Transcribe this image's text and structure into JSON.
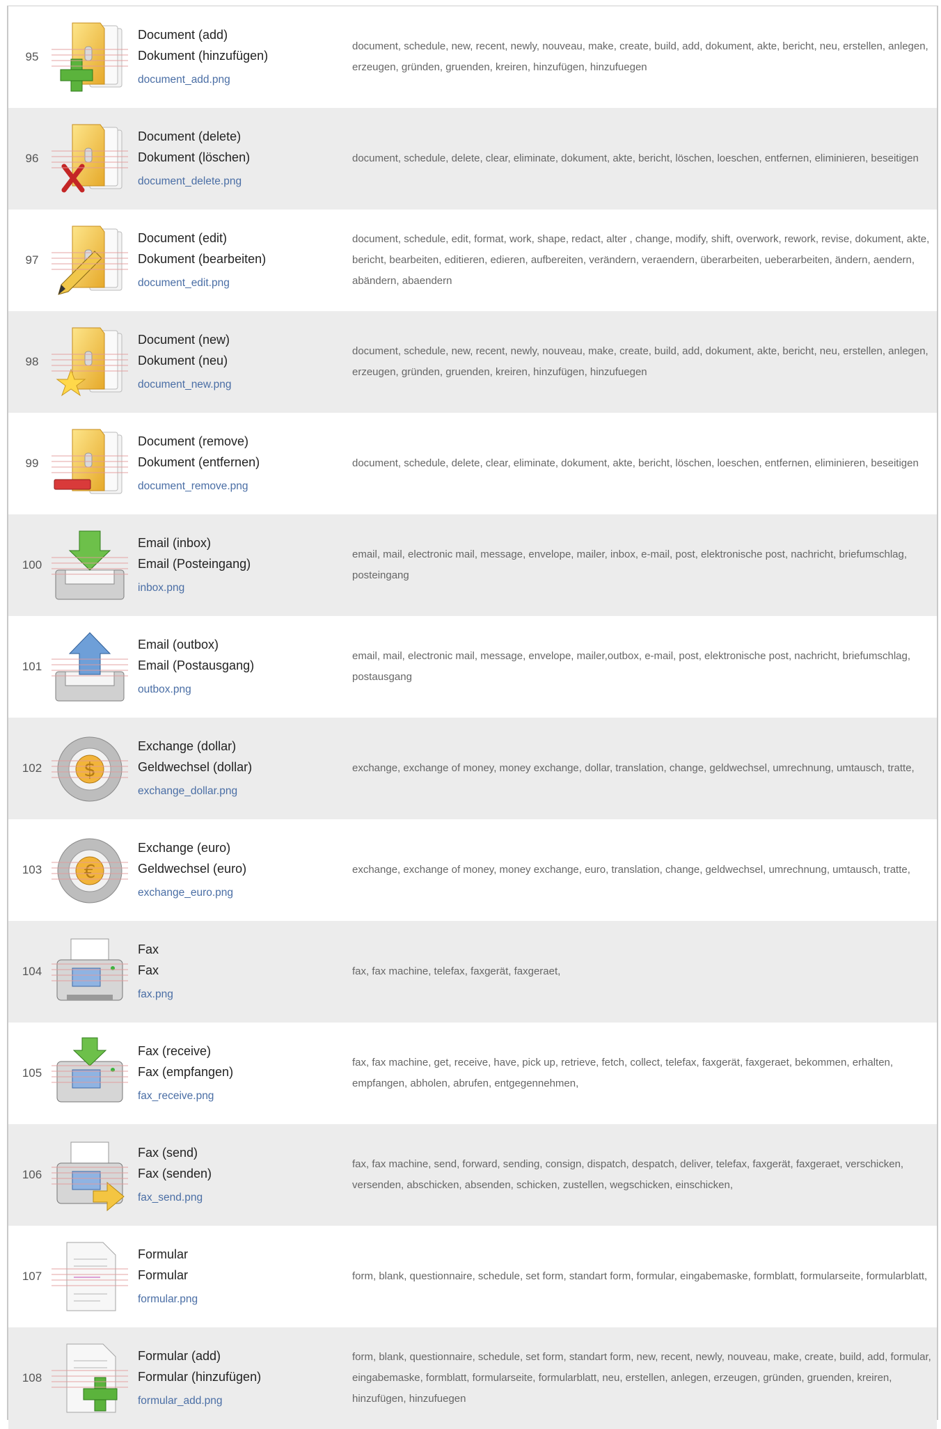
{
  "rows": [
    {
      "num": "95",
      "name1": "Document (add)",
      "name2": "Dokument (hinzufügen)",
      "file": "document_add.png",
      "icon": "document-add-icon",
      "keywords": "document, schedule, new, recent, newly, nouveau, make, create, build, add, dokument, akte, bericht, neu, erstellen, anlegen, erzeugen, gründen, gruenden, kreiren, hinzufügen, hinzufuegen"
    },
    {
      "num": "96",
      "name1": "Document (delete)",
      "name2": "Dokument (löschen)",
      "file": "document_delete.png",
      "icon": "document-delete-icon",
      "keywords": "document, schedule, delete, clear, eliminate, dokument, akte, bericht, löschen, loeschen, entfernen, eliminieren, beseitigen"
    },
    {
      "num": "97",
      "name1": "Document (edit)",
      "name2": "Dokument (bearbeiten)",
      "file": "document_edit.png",
      "icon": "document-edit-icon",
      "keywords": "document, schedule, edit, format, work, shape, redact, alter , change, modify, shift, overwork, rework, revise, dokument, akte, bericht, bearbeiten, editieren, edieren, aufbereiten, verändern, veraendern, überarbeiten, ueberarbeiten, ändern, aendern, abändern, abaendern"
    },
    {
      "num": "98",
      "name1": "Document (new)",
      "name2": "Dokument (neu)",
      "file": "document_new.png",
      "icon": "document-new-icon",
      "keywords": "document, schedule, new, recent, newly, nouveau, make, create, build, add, dokument, akte, bericht, neu, erstellen, anlegen, erzeugen, gründen, gruenden, kreiren, hinzufügen, hinzufuegen"
    },
    {
      "num": "99",
      "name1": "Document (remove)",
      "name2": "Dokument (entfernen)",
      "file": "document_remove.png",
      "icon": "document-remove-icon",
      "keywords": "document, schedule, delete, clear, eliminate, dokument, akte, bericht, löschen, loeschen, entfernen, eliminieren, beseitigen"
    },
    {
      "num": "100",
      "name1": "Email (inbox)",
      "name2": "Email (Posteingang)",
      "file": "inbox.png",
      "icon": "inbox-icon",
      "keywords": "email, mail, electronic mail, message, envelope, mailer, inbox, e-mail, post, elektronische post, nachricht, briefumschlag, posteingang"
    },
    {
      "num": "101",
      "name1": "Email (outbox)",
      "name2": "Email (Postausgang)",
      "file": "outbox.png",
      "icon": "outbox-icon",
      "keywords": "email, mail, electronic mail, message, envelope, mailer,outbox, e-mail, post, elektronische post, nachricht, briefumschlag, postausgang"
    },
    {
      "num": "102",
      "name1": "Exchange (dollar)",
      "name2": "Geldwechsel (dollar)",
      "file": "exchange_dollar.png",
      "icon": "exchange-dollar-icon",
      "keywords": "exchange, exchange of money, money exchange, dollar, translation, change, geldwechsel, umrechnung, umtausch, tratte,"
    },
    {
      "num": "103",
      "name1": "Exchange (euro)",
      "name2": "Geldwechsel (euro)",
      "file": "exchange_euro.png",
      "icon": "exchange-euro-icon",
      "keywords": "exchange, exchange of money, money exchange, euro, translation, change, geldwechsel, umrechnung, umtausch, tratte,"
    },
    {
      "num": "104",
      "name1": "Fax",
      "name2": "Fax",
      "file": "fax.png",
      "icon": "fax-icon",
      "keywords": "fax, fax machine, telefax, faxgerät, faxgeraet,"
    },
    {
      "num": "105",
      "name1": "Fax (receive)",
      "name2": "Fax (empfangen)",
      "file": "fax_receive.png",
      "icon": "fax-receive-icon",
      "keywords": "fax, fax machine, get, receive, have, pick up, retrieve, fetch, collect, telefax, faxgerät, faxgeraet, bekommen, erhalten, empfangen, abholen, abrufen, entgegennehmen,"
    },
    {
      "num": "106",
      "name1": "Fax (send)",
      "name2": "Fax (senden)",
      "file": "fax_send.png",
      "icon": "fax-send-icon",
      "keywords": "fax, fax machine, send, forward, sending, consign, dispatch, despatch, deliver, telefax, faxgerät, faxgeraet, verschicken, versenden, abschicken, absenden, schicken, zustellen, wegschicken, einschicken,"
    },
    {
      "num": "107",
      "name1": "Formular",
      "name2": "Formular",
      "file": "formular.png",
      "icon": "formular-icon",
      "keywords": "form, blank, questionnaire, schedule, set form, standart form, formular, eingabemaske, formblatt, formularseite, formularblatt,"
    },
    {
      "num": "108",
      "name1": "Formular (add)",
      "name2": "Formular (hinzufügen)",
      "file": "formular_add.png",
      "icon": "formular-add-icon",
      "keywords": "form, blank, questionnaire, schedule, set form, standart form, new, recent, newly, nouveau, make, create, build, add, formular, eingabemaske, formblatt, formularseite, formularblatt, neu, erstellen, anlegen, erzeugen, gründen, gruenden, kreiren, hinzufügen, hinzufuegen"
    }
  ]
}
